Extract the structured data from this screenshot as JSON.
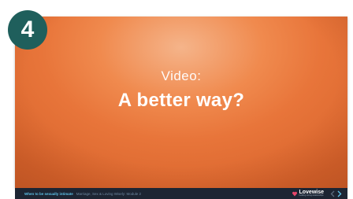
{
  "badge": {
    "number": "4"
  },
  "slide": {
    "subtitle": "Video:",
    "title": "A better way?"
  },
  "footer": {
    "course": "When to be sexually intimate",
    "module": "Marriage, Sex & Loving Wisely: Module 2",
    "brand_name": "Lovewise",
    "brand_tag": "building strong relationships"
  },
  "colors": {
    "badge": "#1f5f5c",
    "slide_orange": "#e8753a",
    "footer_bg": "#1d2533",
    "footer_accent": "#5ec3ea",
    "brand_icon": "#e8476a",
    "nav_prev": "#5a6b7e",
    "nav_next": "#5ec3ea"
  },
  "icons": {
    "brand": "lovewise-logo-icon",
    "prev": "chevron-left-icon",
    "next": "chevron-right-icon"
  }
}
